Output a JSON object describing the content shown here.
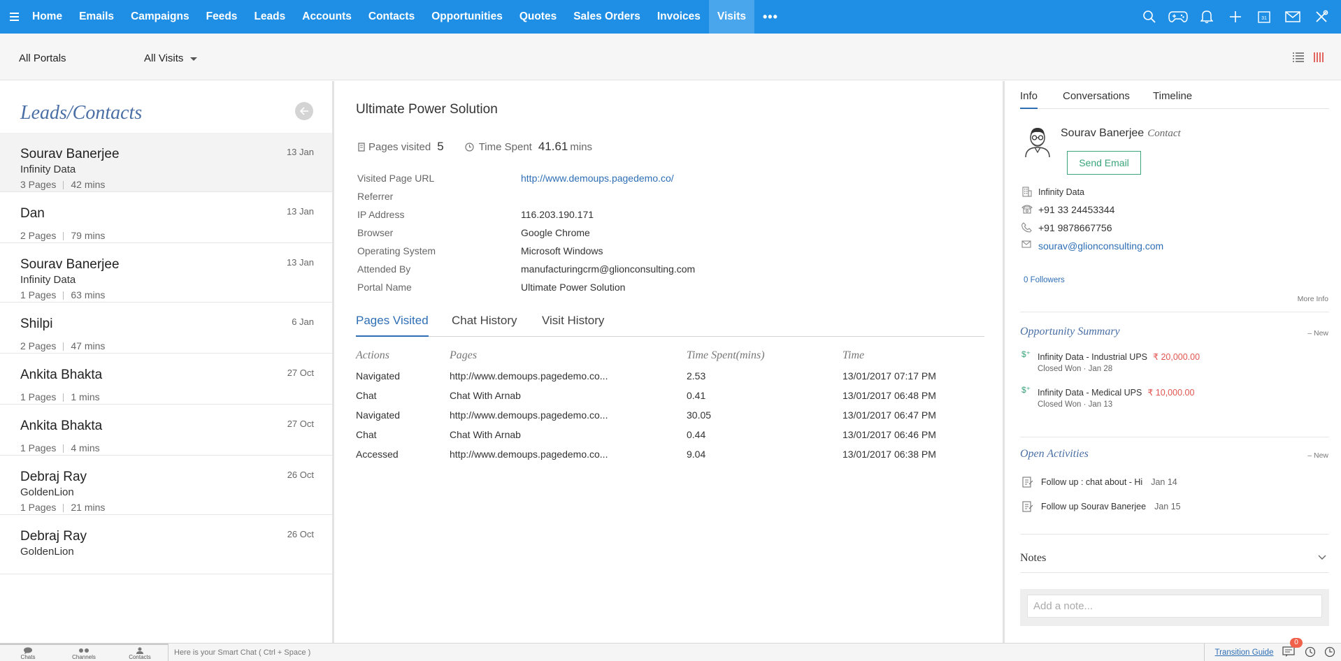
{
  "nav": {
    "items": [
      "Home",
      "Emails",
      "Campaigns",
      "Feeds",
      "Leads",
      "Accounts",
      "Contacts",
      "Opportunities",
      "Quotes",
      "Sales Orders",
      "Invoices",
      "Visits"
    ],
    "active": "Visits",
    "more": "•••",
    "icons": [
      "search-icon",
      "gamepad-icon",
      "bell-icon",
      "plus-icon",
      "calendar-icon",
      "mail-icon",
      "tools-icon"
    ],
    "bar_color": "#1f8fe6"
  },
  "filters": {
    "portal": "All Portals",
    "visits": "All Visits"
  },
  "left": {
    "title": "Leads/Contacts",
    "visitors": [
      {
        "name": "Sourav Banerjee",
        "company": "Infinity Data",
        "pages": "3 Pages",
        "time": "42 mins",
        "date": "13 Jan"
      },
      {
        "name": "Dan",
        "company": "",
        "pages": "2 Pages",
        "time": "79 mins",
        "date": "13 Jan"
      },
      {
        "name": "Sourav Banerjee",
        "company": "Infinity Data",
        "pages": "1 Pages",
        "time": "63 mins",
        "date": "13 Jan"
      },
      {
        "name": "Shilpi",
        "company": "",
        "pages": "2 Pages",
        "time": "47 mins",
        "date": "6 Jan"
      },
      {
        "name": "Ankita Bhakta",
        "company": "",
        "pages": "1 Pages",
        "time": "1 mins",
        "date": "27 Oct"
      },
      {
        "name": "Ankita Bhakta",
        "company": "",
        "pages": "1 Pages",
        "time": "4 mins",
        "date": "27 Oct"
      },
      {
        "name": "Debraj Ray",
        "company": "GoldenLion",
        "pages": "1 Pages",
        "time": "21 mins",
        "date": "26 Oct"
      },
      {
        "name": "Debraj Ray",
        "company": "GoldenLion",
        "pages": "",
        "time": "",
        "date": "26 Oct"
      }
    ]
  },
  "visit": {
    "title": "Ultimate Power Solution",
    "pages_visited_label": "Pages visited",
    "pages_visited": "5",
    "time_spent_label": "Time Spent",
    "time_spent": "41.61",
    "time_unit": "mins",
    "details": [
      {
        "label": "Visited Page URL",
        "value": "http://www.demoups.pagedemo.co/",
        "link": true
      },
      {
        "label": "Referrer",
        "value": ""
      },
      {
        "label": "IP Address",
        "value": "116.203.190.171"
      },
      {
        "label": "Browser",
        "value": "Google Chrome"
      },
      {
        "label": "Operating System",
        "value": "Microsoft Windows"
      },
      {
        "label": "Attended By",
        "value": "manufacturingcrm@glionconsulting.com"
      },
      {
        "label": "Portal Name",
        "value": "Ultimate Power Solution"
      }
    ],
    "tabs": [
      "Pages Visited",
      "Chat History",
      "Visit History"
    ],
    "active_tab": "Pages Visited",
    "table": {
      "headers": [
        "Actions",
        "Pages",
        "Time Spent(mins)",
        "Time"
      ],
      "rows": [
        [
          "Navigated",
          "http://www.demoups.pagedemo.co...",
          "2.53",
          "13/01/2017 07:17 PM"
        ],
        [
          "Chat",
          "Chat With Arnab",
          "0.41",
          "13/01/2017 06:48 PM"
        ],
        [
          "Navigated",
          "http://www.demoups.pagedemo.co...",
          "30.05",
          "13/01/2017 06:47 PM"
        ],
        [
          "Chat",
          "Chat With Arnab",
          "0.44",
          "13/01/2017 06:46 PM"
        ],
        [
          "Accessed",
          "http://www.demoups.pagedemo.co...",
          "9.04",
          "13/01/2017 06:38 PM"
        ]
      ]
    }
  },
  "info": {
    "tabs": [
      "Info",
      "Conversations",
      "Timeline"
    ],
    "active_tab": "Info",
    "contact_name": "Sourav Banerjee",
    "contact_type": "Contact",
    "send_email": "Send Email",
    "company": "Infinity Data",
    "phone": "+91 33 24453344",
    "mobile": "+91 9878667756",
    "email": "sourav@glionconsulting.com",
    "followers": "0 Followers",
    "more_info": "More Info",
    "opportunity_title": "Opportunity Summary",
    "new_label": "– New",
    "opportunities": [
      {
        "name": "Infinity Data - Industrial UPS",
        "amount": "₹ 20,000.00",
        "status": "Closed Won · Jan 28"
      },
      {
        "name": "Infinity Data - Medical UPS",
        "amount": "₹ 10,000.00",
        "status": "Closed Won · Jan 13"
      }
    ],
    "dollar": "$⁺",
    "activities_title": "Open Activities",
    "activities": [
      {
        "text": "Follow up : chat about - Hi",
        "date": "Jan 14"
      },
      {
        "text": "Follow up Sourav Banerjee",
        "date": "Jan 15"
      }
    ],
    "notes_title": "Notes",
    "note_placeholder": "Add a note..."
  },
  "bottom": {
    "tabs": [
      "Chats",
      "Channels",
      "Contacts"
    ],
    "smart_chat": "Here is your Smart Chat ( Ctrl + Space )",
    "transition_guide": "Transition Guide",
    "badge": "0"
  }
}
